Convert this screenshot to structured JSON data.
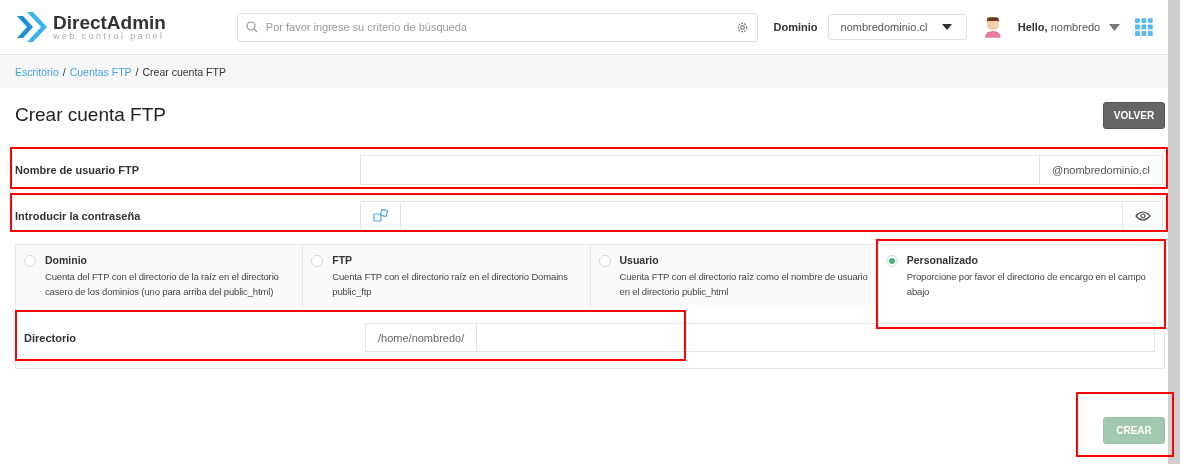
{
  "header": {
    "logo": {
      "name": "DirectAdmin",
      "tagline": "web control panel"
    },
    "search": {
      "placeholder": "Por favor ingrese su criterio de búsqueda"
    },
    "domain_label": "Dominio",
    "domain_select": "nombredominio.cl",
    "user": {
      "greeting": "Hello,",
      "name": "nombredo"
    }
  },
  "breadcrumb": [
    {
      "label": "Escritorio",
      "link": true
    },
    {
      "label": "/",
      "link": false
    },
    {
      "label": "Cuentas FTP",
      "link": true
    },
    {
      "label": "/",
      "link": false
    },
    {
      "label": "Crear cuenta FTP",
      "link": false
    }
  ],
  "title": "Crear cuenta FTP",
  "back_button": "VOLVER",
  "fields": [
    {
      "label": "Nombre de usuario FTP",
      "kind": "suffix",
      "suffix": "@nombredominio.cl"
    },
    {
      "label": "Introducir la contraseña",
      "kind": "password"
    }
  ],
  "directory_options": [
    {
      "title": "Dominio",
      "description": "Cuenta del FTP con el directorio de la raíz en el directorio casero de los dominios (uno para arriba del public_html)",
      "selected": false
    },
    {
      "title": "FTP",
      "description": "Cuenta FTP con el directorio raíz en el directorio Domains public_ftp",
      "selected": false
    },
    {
      "title": "Usuario",
      "description": "Cuenta FTP con el directorio raíz como el nombre de usuario en el directorio public_html",
      "selected": false
    },
    {
      "title": "Personalizado",
      "description": "Proporcione por favor el directorio de encargo en el campo abajo",
      "selected": true
    }
  ],
  "directory": {
    "label": "Directorio",
    "prefix": "/home/nombredo/"
  },
  "create_button": {
    "label": "CREAR",
    "disabled": true
  }
}
